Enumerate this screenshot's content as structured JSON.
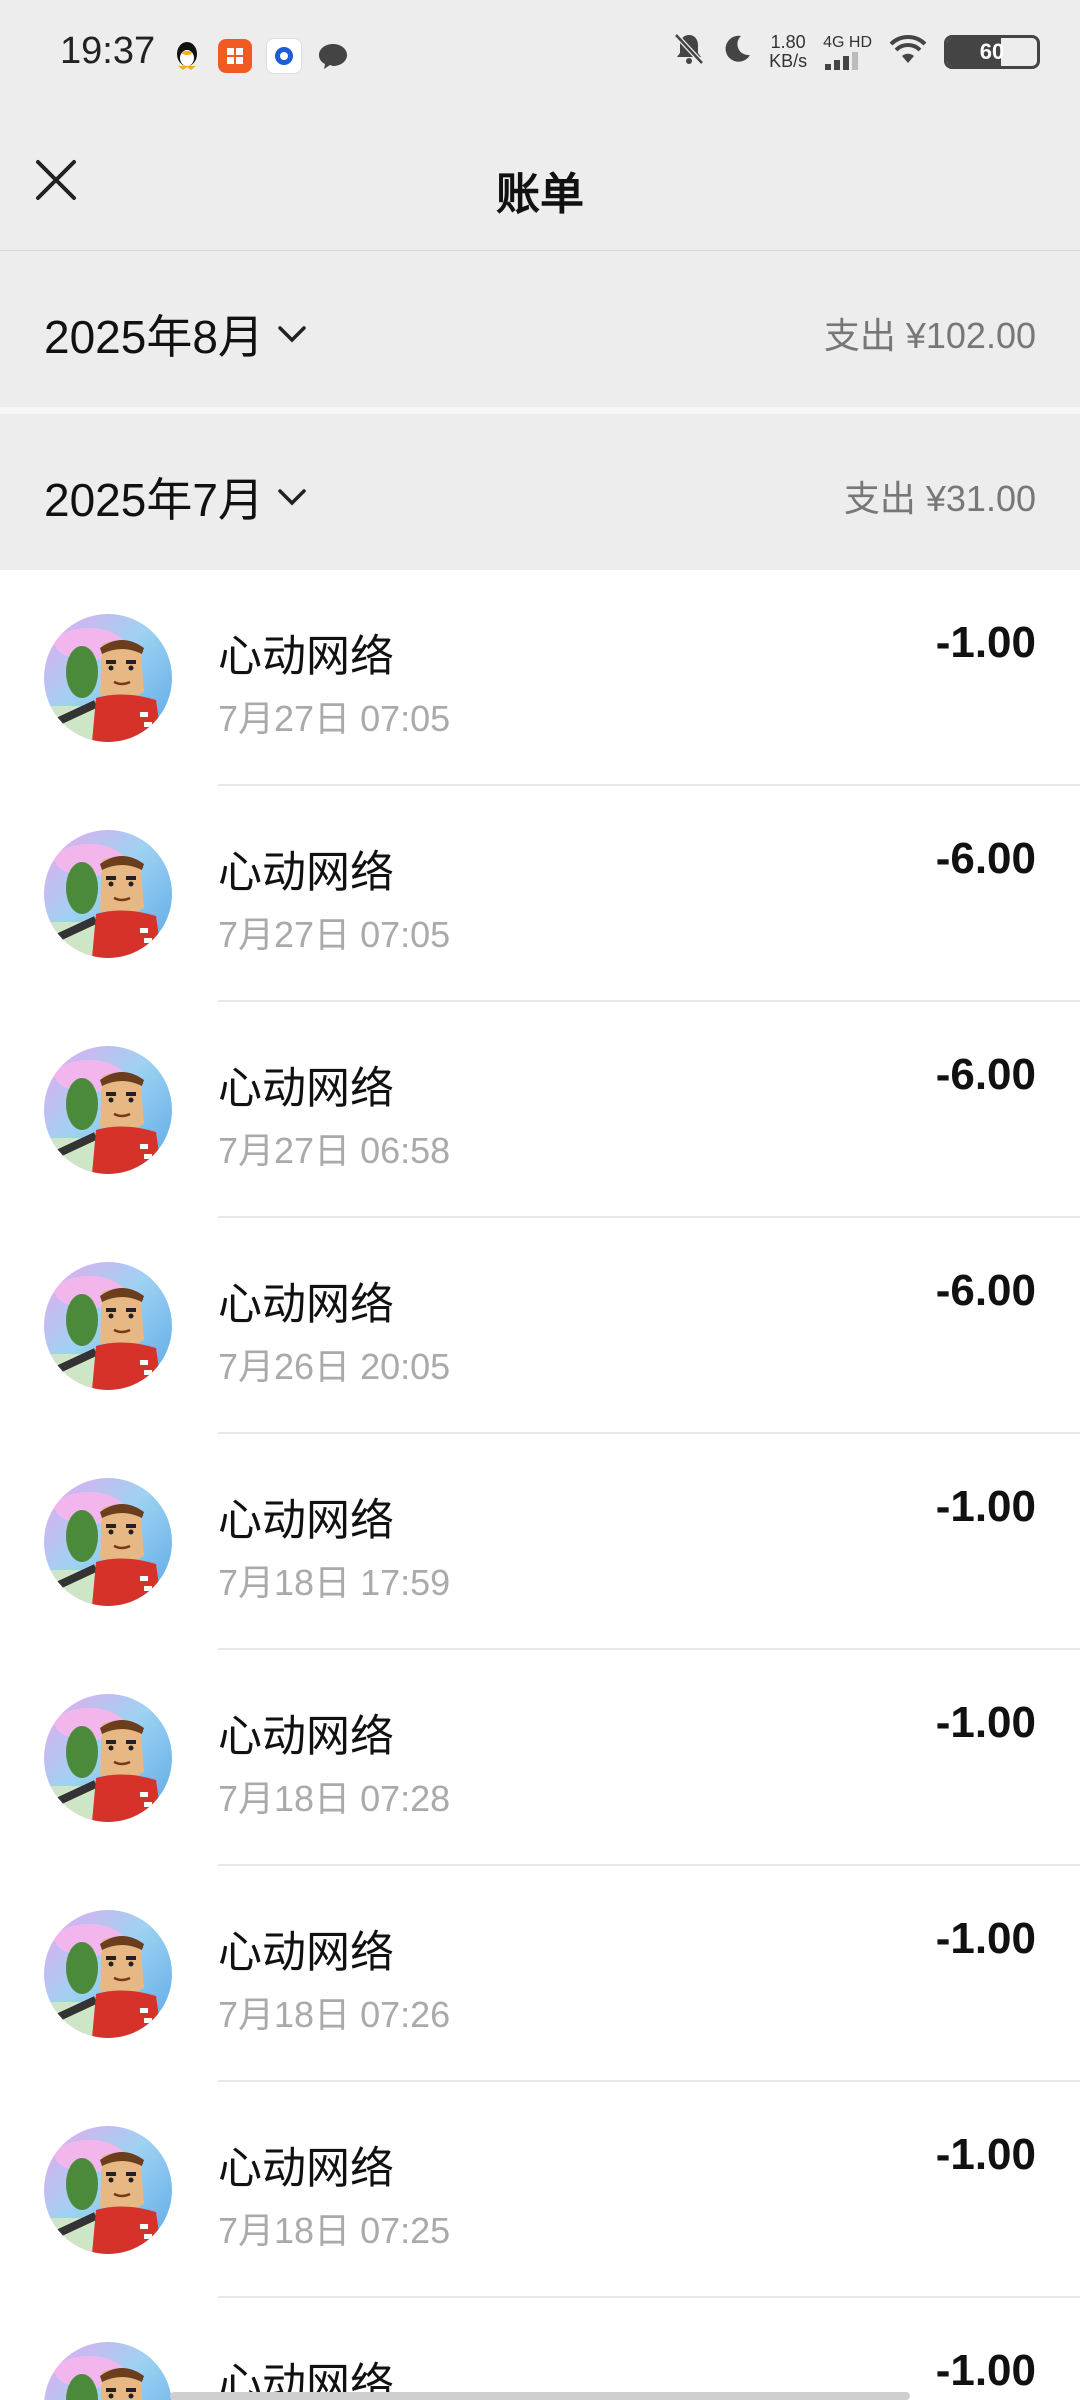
{
  "status_bar": {
    "time": "19:37",
    "net_speed_value": "1.80",
    "net_speed_unit": "KB/s",
    "network_type": "4G HD",
    "battery_level": "60",
    "battery_fraction": 0.6
  },
  "header": {
    "title": "账单"
  },
  "months": [
    {
      "label": "2025年8月",
      "summary": "支出 ¥102.00"
    },
    {
      "label": "2025年7月",
      "summary": "支出 ¥31.00"
    }
  ],
  "transactions": [
    {
      "merchant": "心动网络",
      "time": "7月27日 07:05",
      "amount": "-1.00"
    },
    {
      "merchant": "心动网络",
      "time": "7月27日 07:05",
      "amount": "-6.00"
    },
    {
      "merchant": "心动网络",
      "time": "7月27日 06:58",
      "amount": "-6.00"
    },
    {
      "merchant": "心动网络",
      "time": "7月26日 20:05",
      "amount": "-6.00"
    },
    {
      "merchant": "心动网络",
      "time": "7月18日 17:59",
      "amount": "-1.00"
    },
    {
      "merchant": "心动网络",
      "time": "7月18日 07:28",
      "amount": "-1.00"
    },
    {
      "merchant": "心动网络",
      "time": "7月18日 07:26",
      "amount": "-1.00"
    },
    {
      "merchant": "心动网络",
      "time": "7月18日 07:25",
      "amount": "-1.00"
    },
    {
      "merchant": "心动网络",
      "time": "",
      "amount": "-1.00"
    }
  ],
  "colors": {
    "background": "#ededed",
    "list_background": "#ffffff",
    "secondary_text": "#aaaaaa"
  }
}
